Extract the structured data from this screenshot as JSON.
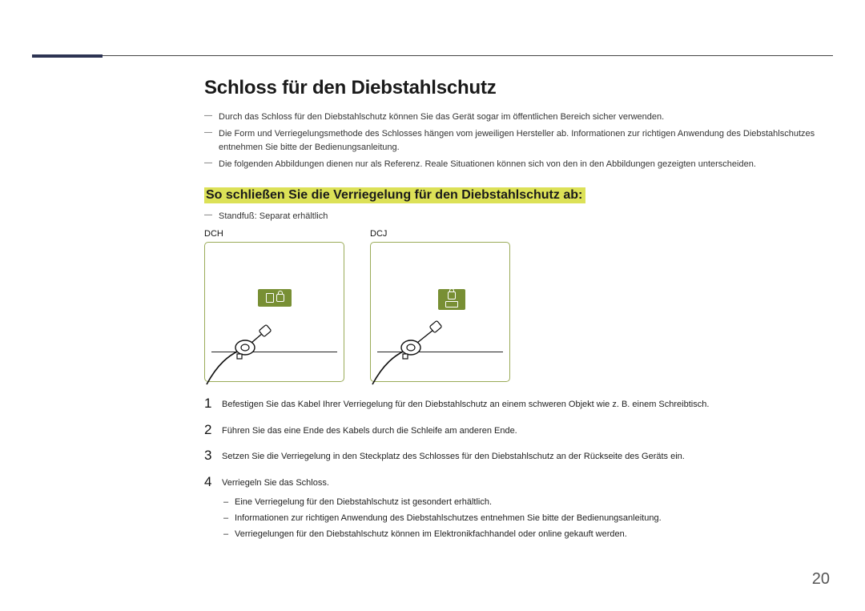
{
  "heading": "Schloss für den Diebstahlschutz",
  "intro_bullets": [
    "Durch das Schloss für den Diebstahlschutz können Sie das Gerät sogar im öffentlichen Bereich sicher verwenden.",
    "Die Form und Verriegelungsmethode des Schlosses hängen vom jeweiligen Hersteller ab. Informationen zur richtigen Anwendung des Diebstahlschutzes entnehmen Sie bitte der Bedienungsanleitung.",
    "Die folgenden Abbildungen dienen nur als Referenz. Reale Situationen können sich von den in den Abbildungen gezeigten unterscheiden."
  ],
  "subheading": "So schließen Sie die Verriegelung für den Diebstahlschutz ab:",
  "stand_note": "Standfuß: Separat erhältlich",
  "figures": {
    "left_label": "DCH",
    "right_label": "DCJ"
  },
  "steps": [
    {
      "num": "1",
      "text": "Befestigen Sie das Kabel Ihrer Verriegelung für den Diebstahlschutz an einem schweren Objekt wie z. B. einem Schreibtisch."
    },
    {
      "num": "2",
      "text": "Führen Sie das eine Ende des Kabels durch die Schleife am anderen Ende."
    },
    {
      "num": "3",
      "text": "Setzen Sie die Verriegelung in den Steckplatz des Schlosses für den Diebstahlschutz an der Rückseite des Geräts ein."
    },
    {
      "num": "4",
      "text": "Verriegeln Sie das Schloss."
    }
  ],
  "notes": [
    "Eine Verriegelung für den Diebstahlschutz ist gesondert erhältlich.",
    "Informationen zur richtigen Anwendung des Diebstahlschutzes entnehmen Sie bitte der Bedienungsanleitung.",
    "Verriegelungen für den Diebstahlschutz können im Elektronikfachhandel oder online gekauft werden."
  ],
  "page_number": "20"
}
